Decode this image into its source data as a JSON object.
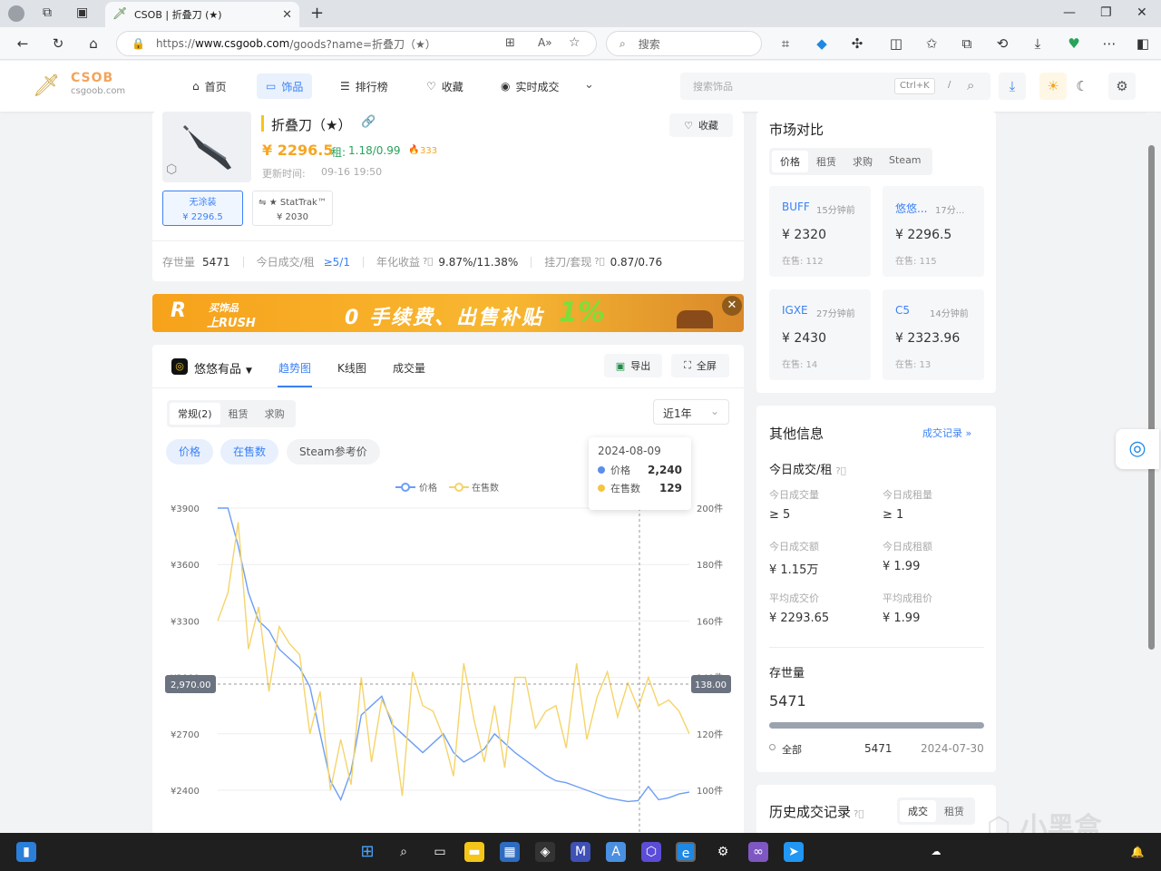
{
  "browser": {
    "tab_title": "CSOB | 折叠刀 (★)",
    "url_prefix": "https://",
    "url_host": "www.csgoob.com",
    "url_path": "/goods?name=折叠刀（★）",
    "search_placeholder": "搜索"
  },
  "site": {
    "logo_title": "CSOB",
    "logo_sub": "csgoob.com",
    "nav": [
      "首页",
      "饰品",
      "排行榜",
      "收藏",
      "实时成交"
    ],
    "active_nav": "饰品",
    "search_placeholder": "搜索饰品",
    "kbd_hint": "Ctrl+K",
    "kbd_slash": "/"
  },
  "item": {
    "name": "折叠刀（★）",
    "price": "¥ 2296.5",
    "rent_label": "租:",
    "rent": "1.18/0.99",
    "hot": "333",
    "updated_label": "更新时间:",
    "updated": "09-16 19:50",
    "favorite": "收藏",
    "variants": [
      {
        "name": "无涂装",
        "price": "¥ 2296.5"
      },
      {
        "name": "⇋ ★ StatTrak™",
        "price": "¥ 2030"
      }
    ],
    "stats": [
      {
        "label": "存世量",
        "value": "5471"
      },
      {
        "label": "今日成交/租",
        "value": "≥5/1"
      },
      {
        "label": "年化收益",
        "value": "9.87%/11.38%"
      },
      {
        "label": "挂刀/套现",
        "value": "0.87/0.76"
      }
    ]
  },
  "banner": {
    "left_top": "买饰品",
    "left_bottom": "上RUSH",
    "slogan": "0 手续费、出售补贴",
    "pct": "1%"
  },
  "chart_panel": {
    "platform": "悠悠有品",
    "tabs": [
      "趋势图",
      "K线图",
      "成交量"
    ],
    "active_tab": "趋势图",
    "export": "导出",
    "fullscreen": "全屏",
    "sub_tabs": [
      "常规(2)",
      "租赁",
      "求购"
    ],
    "range": "近1年",
    "pills": [
      "价格",
      "在售数",
      "Steam参考价"
    ],
    "legend": [
      "价格",
      "在售数"
    ],
    "tooltip": {
      "date": "2024-08-09",
      "rows": [
        {
          "label": "价格",
          "value": "2,240"
        },
        {
          "label": "在售数",
          "value": "129"
        }
      ]
    },
    "crosshair_left": "2,970.00",
    "crosshair_right": "138.00",
    "y_left_ticks": [
      "¥3900",
      "¥3600",
      "¥3300",
      "¥3000",
      "¥2700",
      "¥2400"
    ],
    "y_right_ticks": [
      "200件",
      "180件",
      "160件",
      "140件",
      "120件",
      "100件"
    ]
  },
  "chart_data": {
    "type": "line",
    "title": "",
    "ylim_left": [
      2300,
      3900
    ],
    "ylim_right": [
      95,
      200
    ],
    "series": [
      {
        "name": "价格",
        "axis": "left",
        "values": [
          3900,
          3900,
          3700,
          3450,
          3300,
          3250,
          3150,
          3100,
          3050,
          2950,
          2700,
          2450,
          2350,
          2500,
          2800,
          2850,
          2900,
          2750,
          2700,
          2650,
          2600,
          2650,
          2700,
          2600,
          2550,
          2580,
          2620,
          2700,
          2650,
          2600,
          2560,
          2520,
          2480,
          2450,
          2440,
          2420,
          2400,
          2380,
          2360,
          2350,
          2340,
          2345,
          2420,
          2350,
          2360,
          2380,
          2390
        ]
      },
      {
        "name": "在售数",
        "axis": "right",
        "values": [
          160,
          170,
          195,
          150,
          165,
          135,
          158,
          152,
          148,
          120,
          135,
          100,
          118,
          102,
          140,
          110,
          132,
          125,
          98,
          142,
          130,
          128,
          119,
          105,
          145,
          125,
          110,
          130,
          108,
          140,
          140,
          122,
          128,
          130,
          115,
          145,
          118,
          133,
          142,
          126,
          138,
          129,
          140,
          130,
          132,
          128,
          120
        ]
      }
    ]
  },
  "market": {
    "title": "市场对比",
    "tabs": [
      "价格",
      "租赁",
      "求购",
      "Steam"
    ],
    "cards": [
      {
        "name": "BUFF",
        "time": "15分钟前",
        "price": "¥ 2320",
        "stock": "在售: 112"
      },
      {
        "name": "悠悠...",
        "time": "17分...",
        "price": "¥ 2296.5",
        "stock": "在售: 115"
      },
      {
        "name": "IGXE",
        "time": "27分钟前",
        "price": "¥ 2430",
        "stock": "在售: 14"
      },
      {
        "name": "C5",
        "time": "14分钟前",
        "price": "¥ 2323.96",
        "stock": "在售: 13"
      }
    ]
  },
  "other": {
    "title": "其他信息",
    "link": "成交记录 »",
    "section": "今日成交/租",
    "cells": [
      {
        "label": "今日成交量",
        "value": "≥ 5"
      },
      {
        "label": "今日成租量",
        "value": "≥ 1"
      },
      {
        "label": "今日成交额",
        "value": "¥ 1.15万"
      },
      {
        "label": "今日成租额",
        "value": "¥ 1.99"
      },
      {
        "label": "平均成交价",
        "value": "¥ 2293.65"
      },
      {
        "label": "平均成租价",
        "value": "¥ 1.99"
      }
    ],
    "stock_title": "存世量",
    "stock_value": "5471",
    "stock_row": {
      "label": "全部",
      "value": "5471",
      "date": "2024-07-30"
    }
  },
  "history": {
    "title": "历史成交记录",
    "tabs": [
      "成交",
      "租赁"
    ]
  },
  "watermark": "小黑盒"
}
